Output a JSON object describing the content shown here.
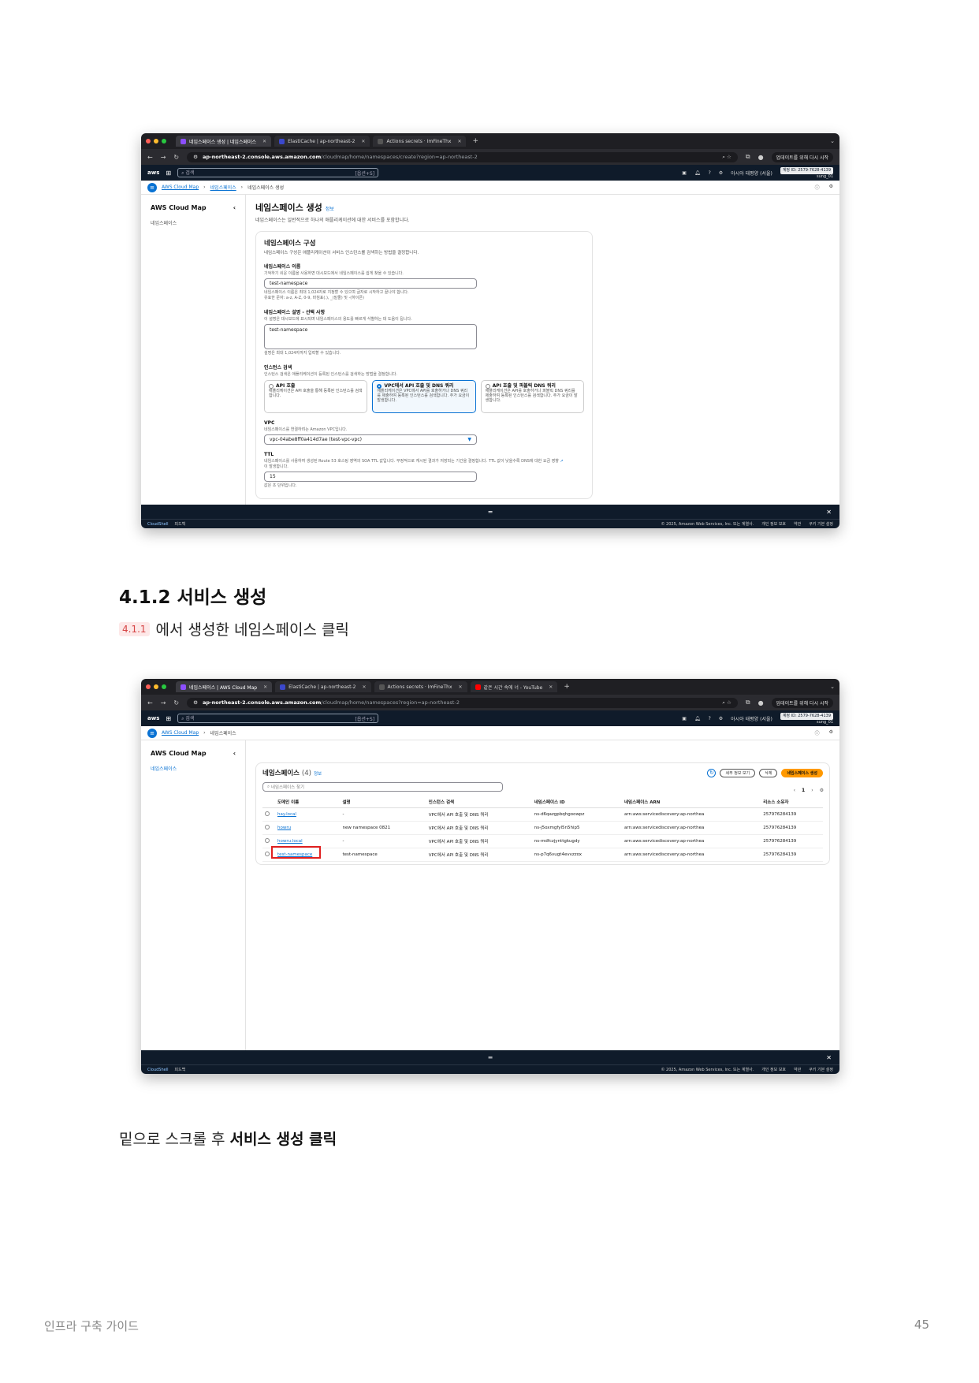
{
  "doc": {
    "section_title": "4.1.2 서비스 생성",
    "ref_badge": "4.1.1",
    "line1_text": "에서 생성한 네임스페이스 클릭",
    "line2_prefix": "밑으로 스크롤 후 ",
    "line2_bold": "서비스 생성 클릭",
    "footer_left": "인프라 구축 가이드",
    "page_number": "45"
  },
  "browser": {
    "shot1_tabs": [
      "네임스페이스 생성 | 네임스페이스",
      "ElastiCache | ap-northeast-2",
      "Actions secrets · ImFineThx"
    ],
    "shot2_tabs": [
      "네임스페이스 | AWS Cloud Map",
      "ElastiCache | ap-northeast-2",
      "Actions secrets · ImFineThx",
      "같은 시간 속에 너 - YouTube"
    ],
    "shot1_host": "ap-northeast-2.console.aws.amazon.com",
    "shot1_path": "/cloudmap/home/namespaces/create?region=ap-northeast-2",
    "shot2_host": "ap-northeast-2.console.aws.amazon.com",
    "shot2_path": "/cloudmap/home/namespaces?region=ap-northeast-2",
    "update_label": "업데이트를 위해 다시 시작",
    "search_placeholder": "검색",
    "search_shortcut": "[옵션+S]",
    "account_id": "계정 ID: 2579-7628-4139",
    "user": "sung_01",
    "region": "아시아 태평양 (서울)",
    "cloudshell": "CloudShell",
    "feedback": "피드백",
    "copyright": "© 2025, Amazon Web Services, Inc. 또는 계열사.",
    "privacy": "개인 정보 보호",
    "terms": "약관",
    "cookie": "쿠키 기본 설정"
  },
  "console": {
    "service_name": "AWS Cloud Map",
    "side_item": "네임스페이스",
    "crumb1": "AWS Cloud Map",
    "crumb2": "네임스페이스",
    "crumb3": "네임스페이스 생성",
    "info": "정보"
  },
  "form": {
    "title": "네임스페이스 생성",
    "desc": "네임스페이스는 일반적으로 하나의 애플리케이션에 대한 서비스를 포함합니다.",
    "panel_title": "네임스페이스 구성",
    "panel_desc": "네임스페이스 구성은 애플리케이션이 서비스 인스턴스를 검색하는 방법을 결정합니다.",
    "name_label": "네임스페이스 이름",
    "name_hint": "기억하기 쉬운 이름을 사용하면 대시보드에서 네임스페이스를 쉽게 찾을 수 있습니다.",
    "name_value": "test-namespace",
    "name_help1": "네임스페이스 이름은 최대 1,024자로 지정할 수 있으며 글자로 시작하고 끝나야 합니다.",
    "name_help2": "유효한 문자: a-z, A-Z, 0-9, 마침표(.), _(밑줄) 및 -(하이픈)",
    "desc_label": "네임스페이스 설명 - 선택 사항",
    "desc_hint": "이 설명은 대시보드에 표시되며 네임스페이스의 용도를 빠르게 식별하는 데 도움이 됩니다.",
    "desc_value": "test-namespace",
    "desc_help": "설명은 최대 1,024자까지 입력할 수 있습니다.",
    "disc_label": "인스턴스 검색",
    "disc_hint": "인스턴스 검색은 애플리케이션이 등록된 인스턴스를 검색하는 방법을 결정합니다.",
    "opt1_title": "API 호출",
    "opt1_desc": "애플리케이션은 API 호출을 통해 등록된 인스턴스를 검색합니다.",
    "opt2_title": "VPC에서 API 호출 및 DNS 쿼리",
    "opt2_desc": "애플리케이션은 VPC에서 API를 호출하거나 DNS 쿼리를 제출하여 등록된 인스턴스를 검색합니다. 추가 요금이 발생합니다.",
    "opt3_title": "API 호출 및 퍼블릭 DNS 쿼리",
    "opt3_desc": "애플리케이션은 API를 호출하거나 퍼블릭 DNS 쿼리를 제출하여 등록된 인스턴스를 검색합니다. 추가 요금이 발생합니다.",
    "vpc_label": "VPC",
    "vpc_hint": "네임스페이스를 연결하려는 Amazon VPC입니다.",
    "vpc_value": "vpc-04abe8ff0a414d7ae (test-vpc-vpc)",
    "ttl_label": "TTL",
    "ttl_hint": "네임스페이스를 사용하여 생성된 Route 53 호스팅 영역의 SOA TTL 값입니다. 부정적으로 캐시된 결과가 저장되는 기간을 결정합니다. TTL 값이 낮을수록 DNS에 대한 요금 영향",
    "ttl_hint2": "이 발생합니다.",
    "ttl_value": "15",
    "ttl_help": "값은 초 단위입니다."
  },
  "list": {
    "title": "네임스페이스",
    "count": "(4)",
    "btn_detail": "세부 정보 보기",
    "btn_delete": "삭제",
    "btn_create": "네임스페이스 생성",
    "search_placeholder": "네임스페이스 찾기",
    "page": "1",
    "columns": [
      "도메인 이름",
      "설명",
      "인스턴스 검색",
      "네임스페이스 ID",
      "네임스페이스 ARN",
      "리소스 소유자"
    ],
    "rows": [
      {
        "name": "hay.local",
        "desc": "-",
        "disc": "VPC에서 API 호출 및 DNS 쿼리",
        "id": "ns-d6qazgpbqhgoowpz",
        "arn": "arn:aws:servicediscovery:ap-northea",
        "owner": "257976284139"
      },
      {
        "name": "howru",
        "desc": "new namespace 0821",
        "disc": "VPC에서 API 호출 및 DNS 쿼리",
        "id": "ns-j5oxmgfyl5n5hip5",
        "arn": "arn:aws:servicediscovery:ap-northea",
        "owner": "257976284139"
      },
      {
        "name": "howru.local",
        "desc": "-",
        "disc": "VPC에서 API 호출 및 DNS 쿼리",
        "id": "ns-mdfczjynttgkugdy",
        "arn": "arn:aws:servicediscovery:ap-northea",
        "owner": "257976284139"
      },
      {
        "name": "test-namespace",
        "desc": "test-namespace",
        "disc": "VPC에서 API 호출 및 DNS 쿼리",
        "id": "ns-p7q6vugt4evvzzox",
        "arn": "arn:aws:servicediscovery:ap-northea",
        "owner": "257976284139"
      }
    ]
  },
  "colors": {
    "aws_nav": "#0f1b2a",
    "link": "#0972d3",
    "primary_button": "#ff9900",
    "highlight": "#e02020"
  }
}
